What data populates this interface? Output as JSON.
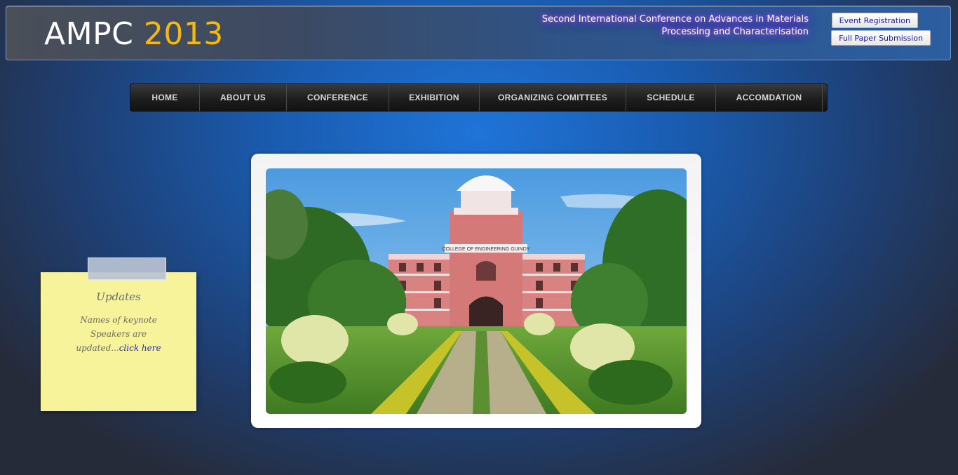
{
  "header": {
    "logo_text": "AMPC",
    "logo_year": "2013",
    "conference_line1": "Second International Conference on Advances in Materials",
    "conference_line2": "Processing and Characterisation",
    "event_registration": "Event Registration",
    "full_paper_submission": "Full Paper Submission"
  },
  "nav": {
    "items": [
      {
        "label": "HOME"
      },
      {
        "label": "ABOUT US"
      },
      {
        "label": "CONFERENCE"
      },
      {
        "label": "EXHIBITION"
      },
      {
        "label": "ORGANIZING COMITTEES"
      },
      {
        "label": "SCHEDULE"
      },
      {
        "label": "ACCOMDATION"
      }
    ]
  },
  "updates": {
    "title": "Updates",
    "text_line1": "Names of keynote",
    "text_line2": "Speakers are",
    "text_line3": "updated...",
    "link": "click here"
  },
  "photo": {
    "building_sign": "COLLEGE OF ENGINEERING GUINDY"
  },
  "colors": {
    "accent_year": "#f4b90f",
    "note_yellow": "#f6f39a",
    "link_blue": "#2424d0"
  }
}
